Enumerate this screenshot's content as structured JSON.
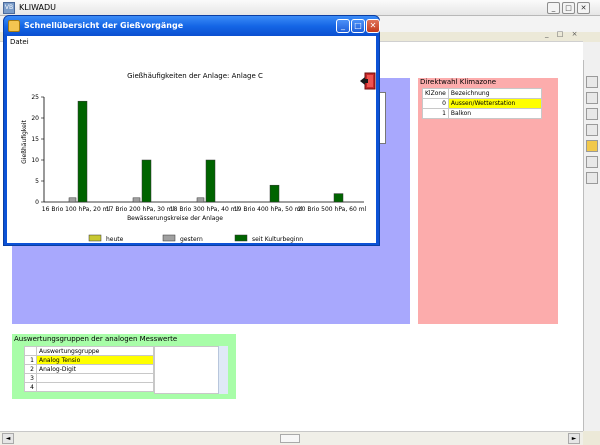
{
  "app": {
    "title": "KLIWADU",
    "icon": "VB"
  },
  "window_buttons": [
    "_",
    "□",
    "✕"
  ],
  "mdi_controls": "_ □ ×",
  "dialog": {
    "title": "Schnellübersicht der Gießvorgänge",
    "menu": "Datei",
    "buttons": [
      "_",
      "□",
      "✕"
    ]
  },
  "chart_data": {
    "type": "bar",
    "title": "Gießhäufigkeiten der Anlage: Anlage C",
    "xlabel": "Bewässerungskreise der Anlage",
    "ylabel": "Gießhäufigkeit",
    "ylim": [
      0,
      25
    ],
    "yticks": [
      0,
      5,
      10,
      15,
      20,
      25
    ],
    "categories": [
      "16 Brio 100 hPa, 20 ml",
      "17 Brio 200 hPa, 30 ml",
      "18 Brio 300 hPa, 40 ml",
      "19 Brio 400 hPa, 50 ml",
      "20 Brio 500 hPa, 60 ml"
    ],
    "series": [
      {
        "name": "heute",
        "color": "#c8c832",
        "values": [
          0,
          0,
          0,
          0,
          0
        ]
      },
      {
        "name": "gestern",
        "color": "#a0a0a0",
        "values": [
          1,
          1,
          1,
          0,
          0
        ]
      },
      {
        "name": "seit Kulturbeginn",
        "color": "#006400",
        "values": [
          24,
          10,
          10,
          4,
          2
        ]
      }
    ],
    "grid": false,
    "legend_position": "bottom"
  },
  "klimazone": {
    "header": "Direktwahl Klimazone",
    "columns": [
      "KlZone",
      "Bezeichnung"
    ],
    "rows": [
      {
        "id": "0",
        "name": "Aussen/Wetterstation",
        "selected": true
      },
      {
        "id": "1",
        "name": "Balkon",
        "selected": false
      }
    ]
  },
  "auswertung": {
    "header": "Auswertungsgruppen der analogen Messwerte",
    "column": "Auswertungsgruppe",
    "rows": [
      {
        "id": "1",
        "name": "Analog Tensio",
        "selected": true
      },
      {
        "id": "2",
        "name": "Analog-Digit",
        "selected": false
      },
      {
        "id": "3",
        "name": "",
        "selected": false
      },
      {
        "id": "4",
        "name": "",
        "selected": false
      }
    ]
  },
  "colors": {
    "blue_panel": "#a8a8fd",
    "pink_panel": "#fcacac",
    "green_panel": "#a8fda8",
    "selection": "#ffff00"
  }
}
